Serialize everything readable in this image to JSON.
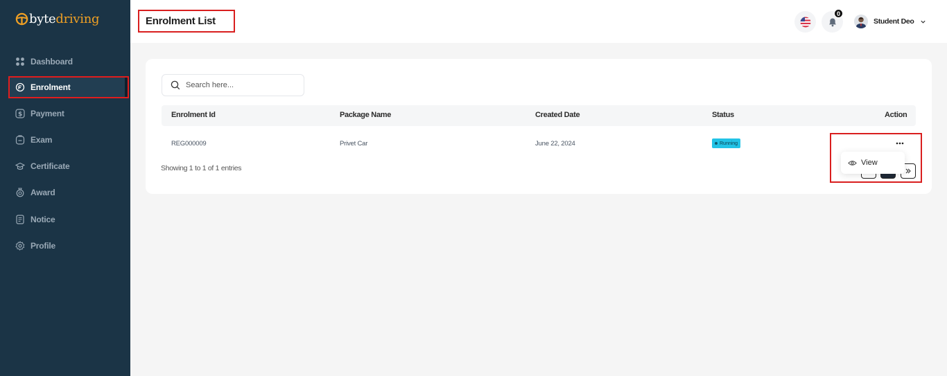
{
  "brand": {
    "part1": "byte",
    "part2": "driving",
    "accent_color": "#f0a024"
  },
  "sidebar": {
    "items": [
      {
        "label": "Dashboard",
        "icon": "grid-icon"
      },
      {
        "label": "Enrolment",
        "icon": "shield-icon",
        "active": true
      },
      {
        "label": "Payment",
        "icon": "dollar-icon"
      },
      {
        "label": "Exam",
        "icon": "clipboard-icon"
      },
      {
        "label": "Certificate",
        "icon": "graduation-cap-icon"
      },
      {
        "label": "Award",
        "icon": "award-icon"
      },
      {
        "label": "Notice",
        "icon": "document-icon"
      },
      {
        "label": "Profile",
        "icon": "gear-icon"
      }
    ]
  },
  "header": {
    "title": "Enrolment List",
    "notification_count": "0",
    "user_name": "Student Deo"
  },
  "search": {
    "placeholder": "Search here..."
  },
  "table": {
    "columns": [
      "Enrolment Id",
      "Package Name",
      "Created Date",
      "Status",
      "Action"
    ],
    "rows": [
      {
        "id": "REG000009",
        "package": "Privet Car",
        "date": "June 22, 2024",
        "status": "Running"
      }
    ],
    "footer": "Showing 1 to 1 of 1 entries"
  },
  "action_menu": {
    "items": [
      {
        "label": "View",
        "icon": "eye-icon"
      }
    ]
  },
  "colors": {
    "sidebar_bg": "#1b3446",
    "status_running": "#22c3e6",
    "highlight_border": "#d91e1e"
  }
}
